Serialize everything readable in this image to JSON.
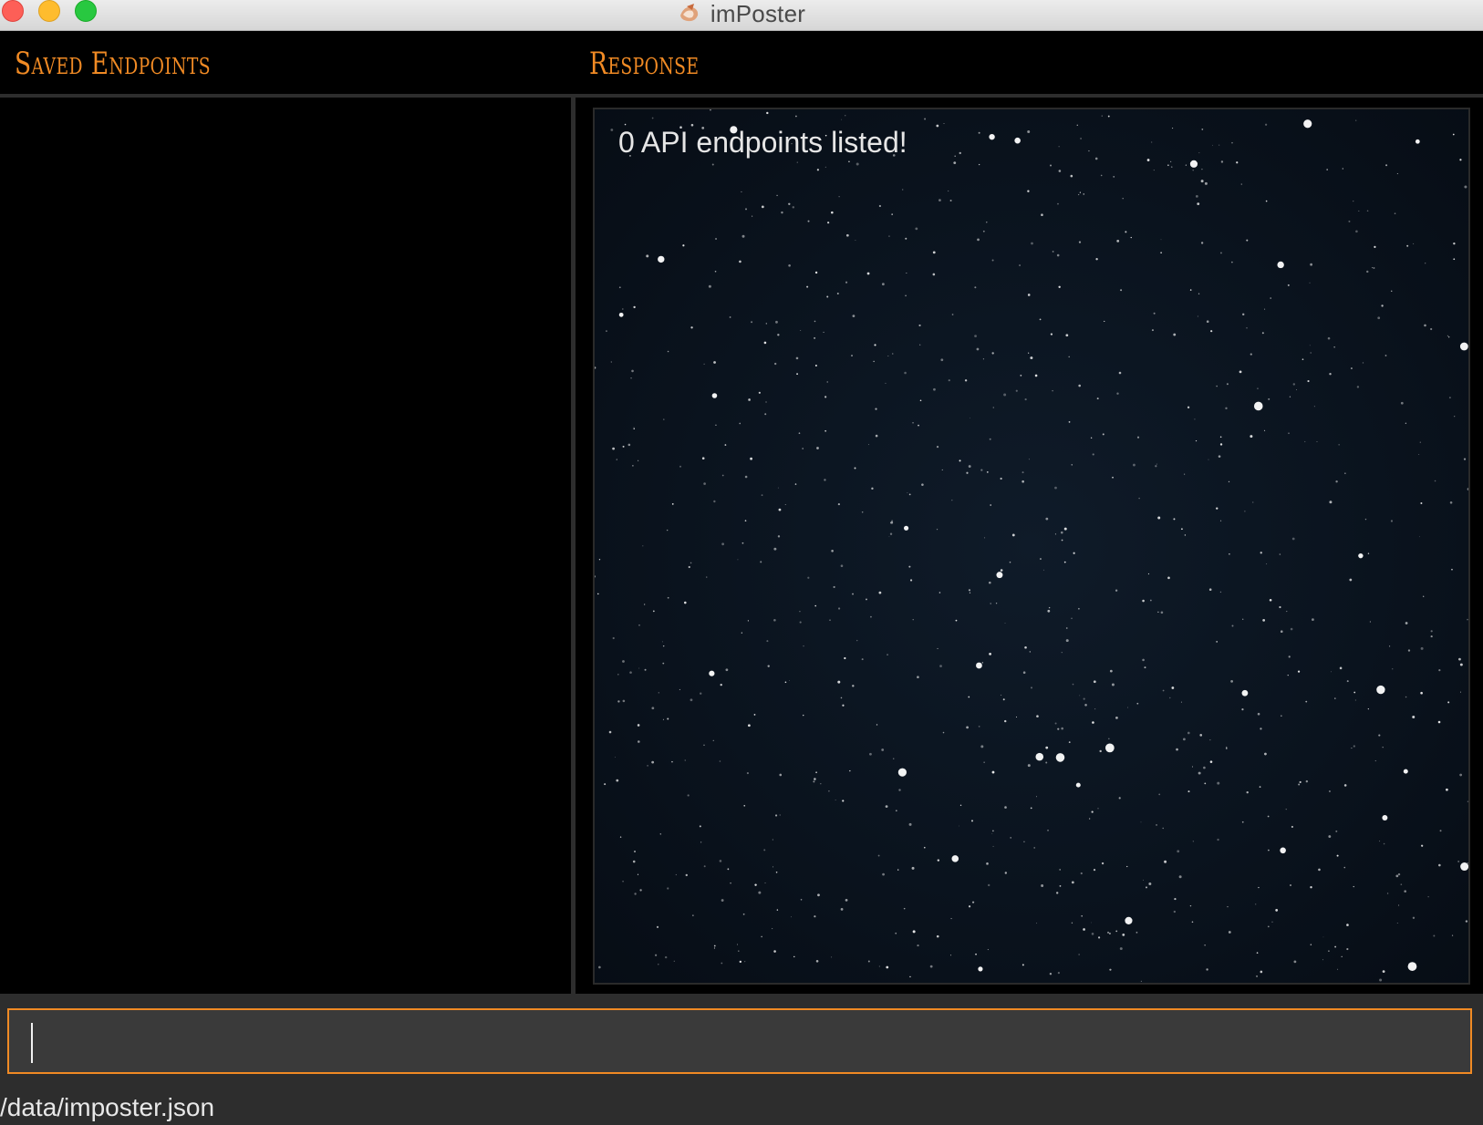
{
  "window": {
    "title": "imPoster",
    "controls": [
      "close-button",
      "minimize-button",
      "zoom-button"
    ]
  },
  "left_panel": {
    "header": "Saved Endpoints",
    "items": []
  },
  "right_panel": {
    "header": "Response",
    "message": "0 API endpoints listed!",
    "background_colors": [
      "#0b1420",
      "#000000"
    ]
  },
  "command_box": {
    "value": "",
    "placeholder": ""
  },
  "status": {
    "file_path": "/data/imposter.json"
  },
  "colors": {
    "accent": "#f08a24",
    "background": "#000000",
    "divider": "#2d2d2d",
    "input_bg": "#3a3a3a"
  }
}
